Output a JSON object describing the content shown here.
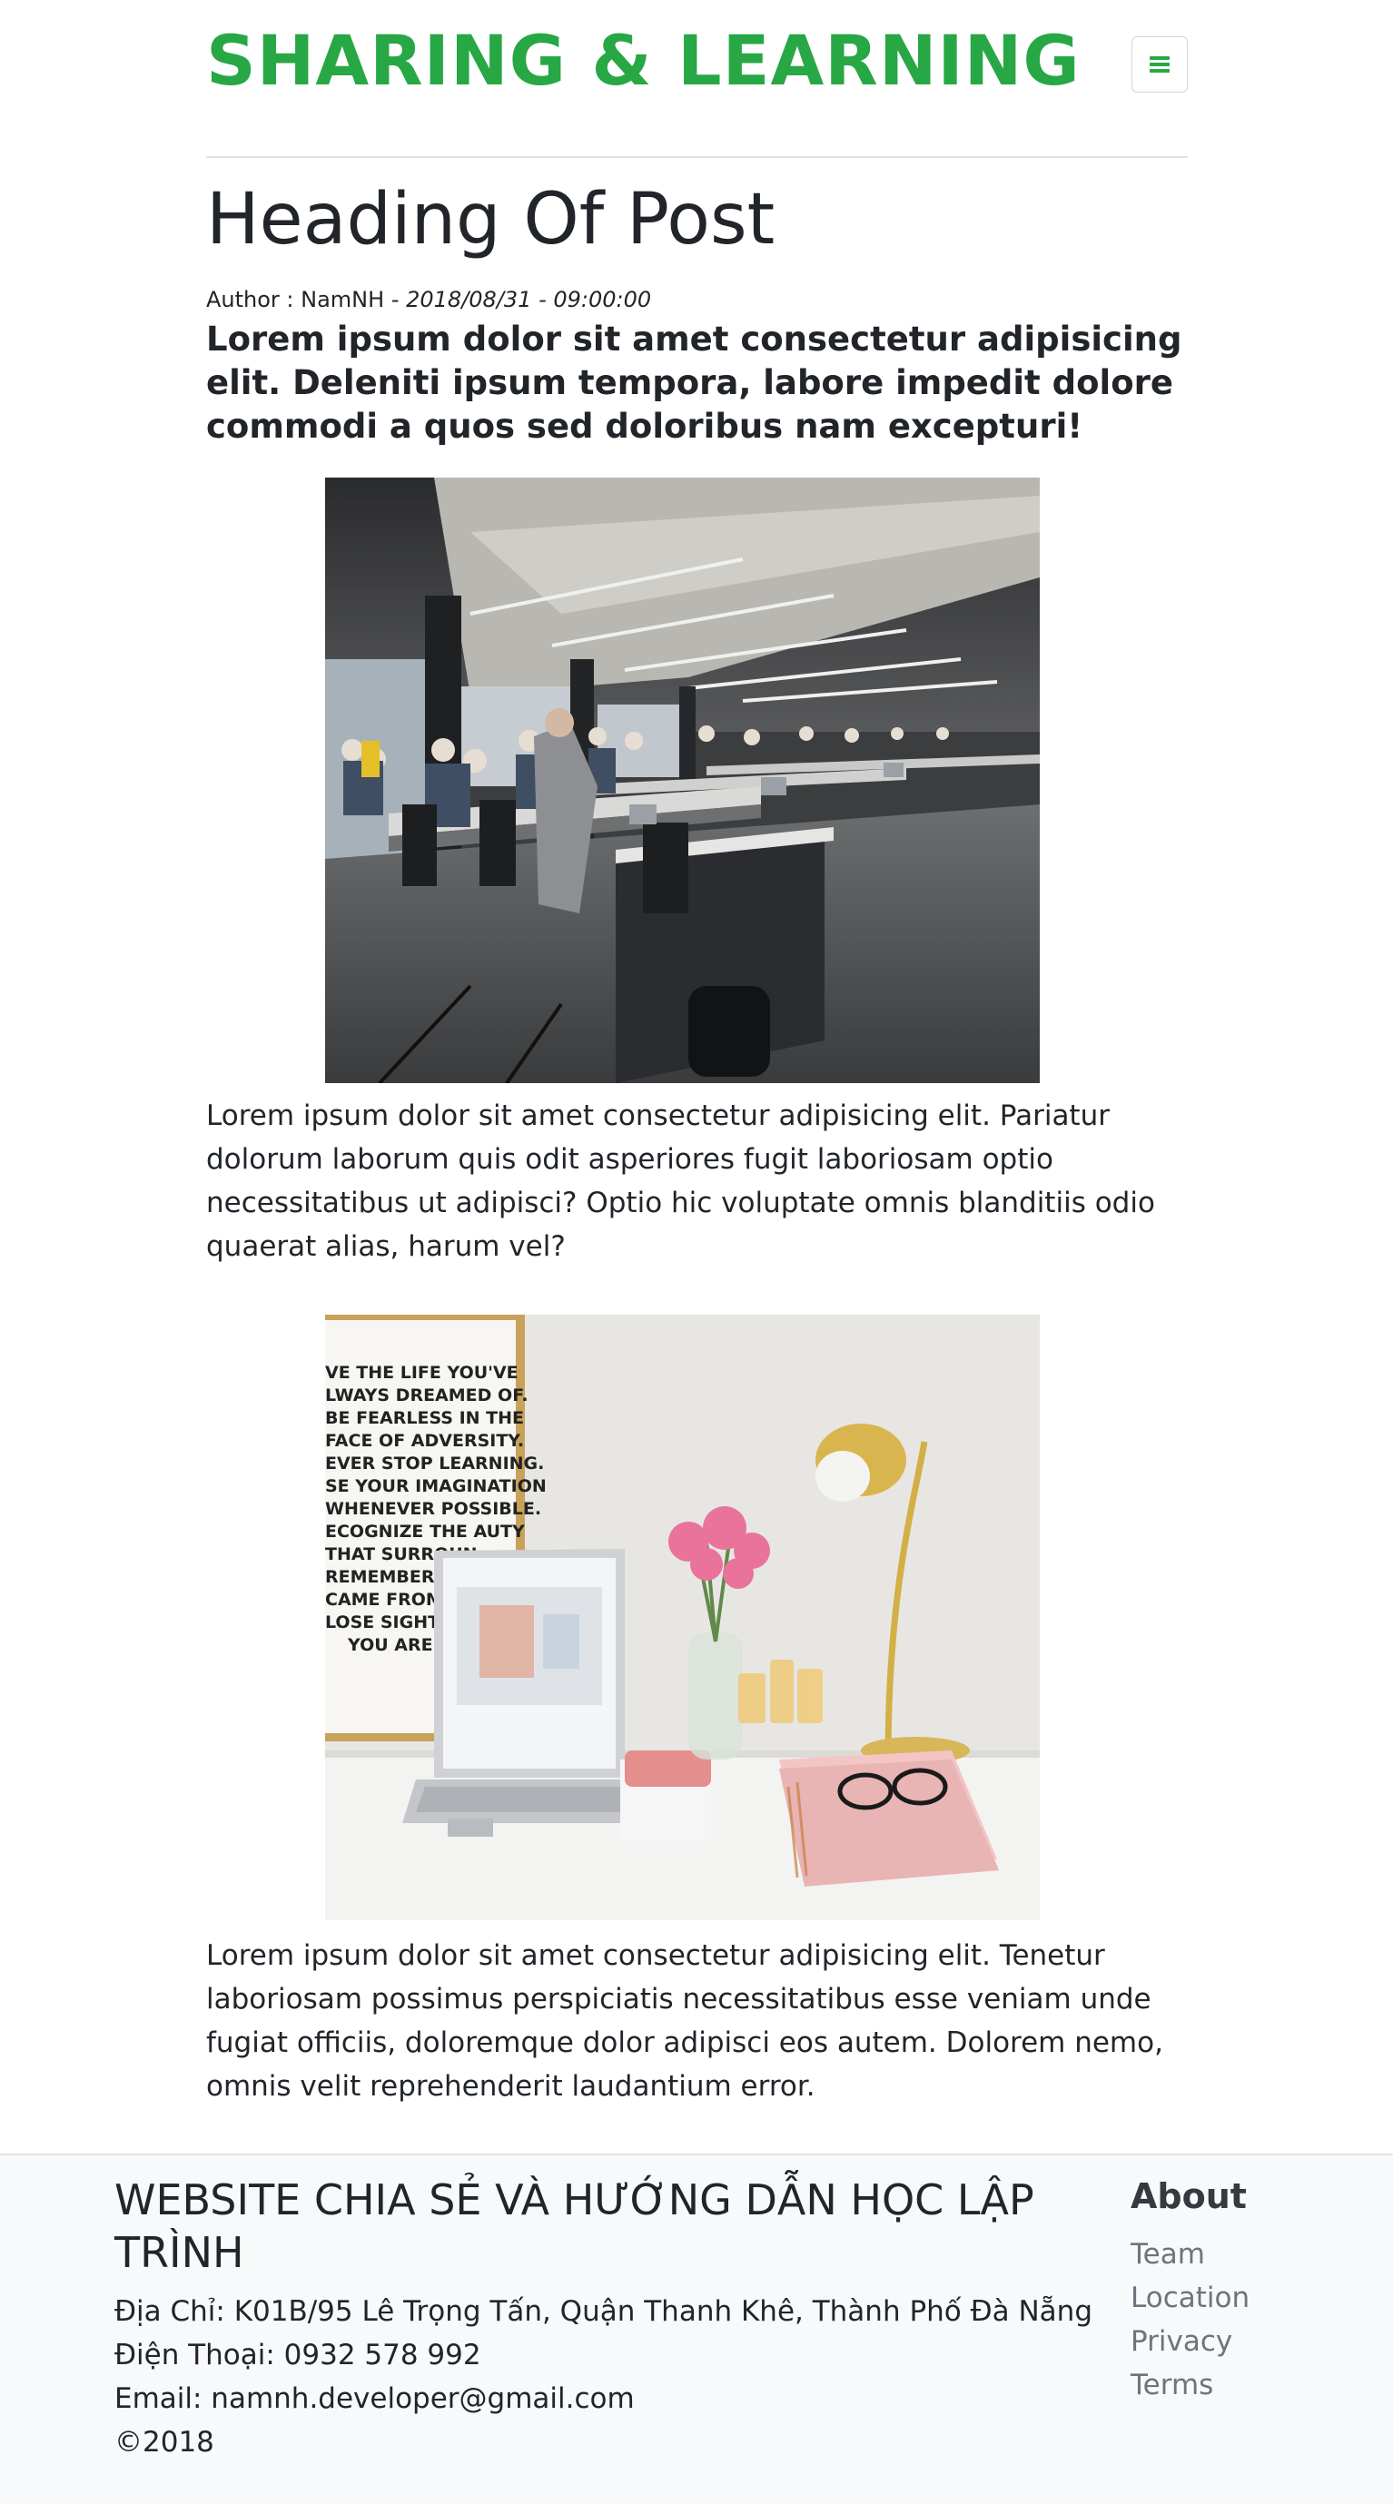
{
  "header": {
    "brand": "SHARING & LEARNING",
    "menu_icon": "hamburger-menu-icon",
    "accent_color": "#28a745"
  },
  "post": {
    "title": "Heading Of Post",
    "author_label": "Author : NamNH",
    "separator": " - ",
    "date": "2018/08/31 - 09:00:00",
    "lead": "Lorem ipsum dolor sit amet consectetur adipisicing elit. Deleniti ipsum tempora, labore impedit dolore commodi a quos sed doloribus nam excepturi!",
    "paragraphs": [
      "Lorem ipsum dolor sit amet consectetur adipisicing elit. Pariatur dolorum laborum quis odit asperiores fugit laboriosam optio necessitatibus ut adipisci? Optio hic voluptate omnis blanditiis odio quaerat alias, harum vel?",
      "Lorem ipsum dolor sit amet consectetur adipisicing elit. Tenetur laboriosam possimus perspiciatis necessitatibus esse veniam unde fugiat officiis, doloremque dolor adipisci eos autem. Dolorem nemo, omnis velit reprehenderit laudantium error."
    ],
    "poster_text": [
      "VE THE LIFE YOU'VE",
      "LWAYS DREAMED OF.",
      "BE FEARLESS IN THE",
      "FACE OF ADVERSITY.",
      "EVER STOP LEARNING.",
      "SE YOUR IMAGINATION",
      "WHENEVER POSSIBLE.",
      "ECOGNIZE THE    AUTY",
      "THAT SURROUN",
      "REMEMBER WH",
      "CAME FROM, BU",
      "LOSE SIGHT OF",
      "YOU ARE GO"
    ]
  },
  "footer": {
    "site_name": "WEBSITE CHIA SẺ VÀ HƯỚNG DẪN HỌC LẬP TRÌNH",
    "address": "Địa Chỉ: K01B/95 Lê Trọng Tấn, Quận Thanh Khê, Thành Phố Đà Nẵng",
    "phone": "Điện Thoại: 0932 578 992",
    "email": "Email: namnh.developer@gmail.com",
    "copyright": "©2018",
    "about_heading": "About",
    "about_links": [
      "Team",
      "Location",
      "Privacy",
      "Terms"
    ]
  }
}
